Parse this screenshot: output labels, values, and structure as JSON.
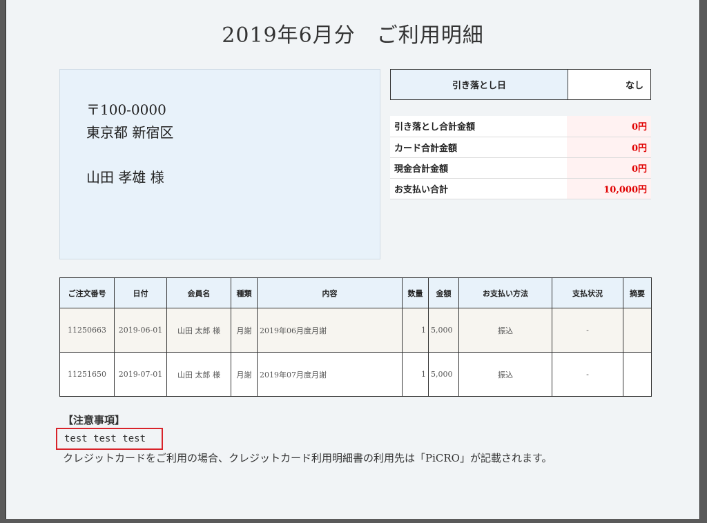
{
  "title": "2019年6月分　ご利用明細",
  "address": {
    "zip": "〒100-0000",
    "city": "東京都 新宿区",
    "name": "山田 孝雄 様"
  },
  "withdrawal_date": {
    "label": "引き落とし日",
    "value": "なし"
  },
  "summary": [
    {
      "label": "引き落とし合計金額",
      "value": "0円"
    },
    {
      "label": "カード合計金額",
      "value": "0円"
    },
    {
      "label": "現金合計金額",
      "value": "0円"
    },
    {
      "label": "お支払い合計",
      "value": "10,000円"
    }
  ],
  "orders": {
    "headers": [
      "ご注文番号",
      "日付",
      "会員名",
      "種類",
      "内容",
      "数量",
      "金額",
      "お支払い方法",
      "支払状況",
      "摘要"
    ],
    "rows": [
      [
        "11250663",
        "2019-06-01",
        "山田 太郎 様",
        "月謝",
        "2019年06月度月謝",
        "1",
        "5,000",
        "振込",
        "-",
        ""
      ],
      [
        "11251650",
        "2019-07-01",
        "山田 太郎 様",
        "月謝",
        "2019年07月度月謝",
        "1",
        "5,000",
        "振込",
        "-",
        ""
      ]
    ]
  },
  "notes": {
    "heading": "【注意事項】",
    "test_line": "test test test",
    "text": "クレジットカードをご利用の場合、クレジットカード利用明細書の利用先は「PiCRO」が記載されます。"
  },
  "colors": {
    "accent_red": "#e00000",
    "highlight_box": "#d8232a",
    "header_blue": "#e8f2fa"
  }
}
